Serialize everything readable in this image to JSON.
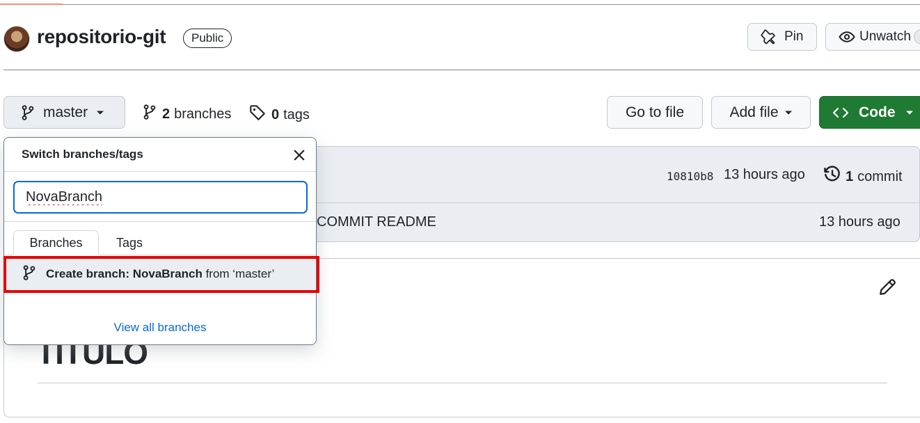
{
  "repo": {
    "name": "repositorio-git",
    "visibility": "Public"
  },
  "header_actions": {
    "pin_label": "Pin",
    "unwatch_label": "Unwatch"
  },
  "toolbar": {
    "current_branch": "master",
    "branches_count": "2",
    "branches_label": "branches",
    "tags_count": "0",
    "tags_label": "tags",
    "go_to_file_label": "Go to file",
    "add_file_label": "Add file",
    "code_label": "Code"
  },
  "commit": {
    "hash": "10810b8",
    "time": "13 hours ago",
    "count": "1",
    "count_label": "commit"
  },
  "file_row": {
    "message": "COMMIT README",
    "time": "13 hours ago"
  },
  "readme": {
    "heading": "TITULO"
  },
  "branch_dropdown": {
    "title": "Switch branches/tags",
    "filter_value": "NovaBranch",
    "tabs": [
      "Branches",
      "Tags"
    ],
    "create_prefix": "Create branch: ",
    "create_name": "NovaBranch",
    "create_suffix": " from ‘master’",
    "view_all_label": "View all branches"
  },
  "colors": {
    "accent_blue": "#0969da",
    "code_button_green": "#1f7a33",
    "highlight_red": "#e60000"
  }
}
